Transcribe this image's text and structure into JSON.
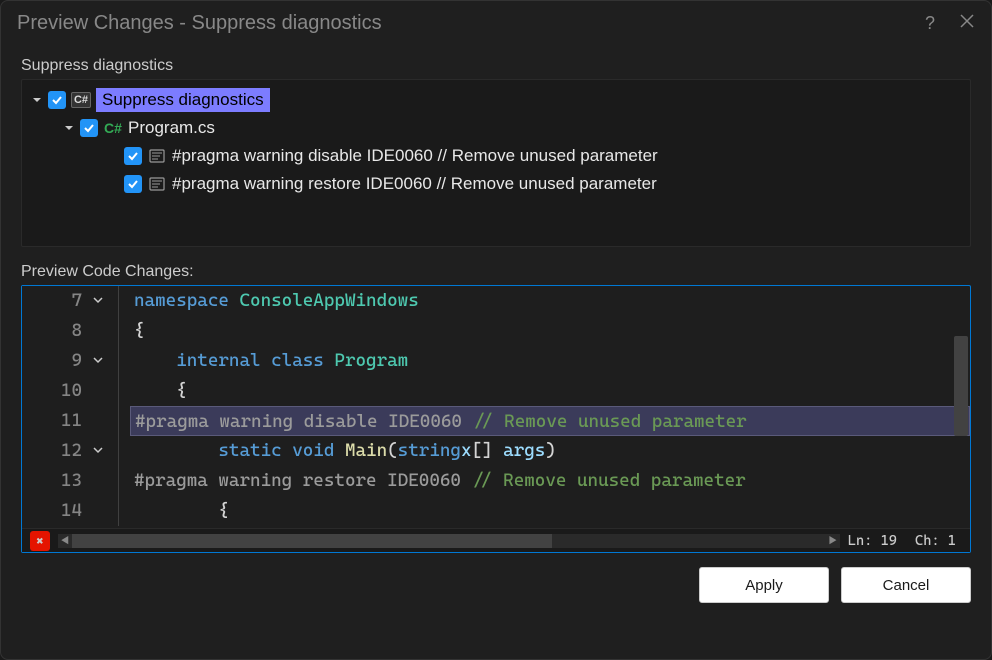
{
  "dialog": {
    "title": "Preview Changes - Suppress diagnostics"
  },
  "tree": {
    "section_label": "Suppress diagnostics",
    "root": {
      "label": "Suppress diagnostics"
    },
    "file": {
      "label": "Program.cs"
    },
    "changes": [
      {
        "label": "#pragma warning disable IDE0060 // Remove unused parameter"
      },
      {
        "label": "#pragma warning restore IDE0060 // Remove unused parameter"
      }
    ]
  },
  "preview": {
    "label": "Preview Code Changes:",
    "lines": [
      {
        "num": "7",
        "fold": "down",
        "tokens": [
          [
            "kw",
            "namespace "
          ],
          [
            "cls",
            "ConsoleAppWindows"
          ]
        ]
      },
      {
        "num": "8",
        "fold": "",
        "tokens": [
          [
            "punct",
            "{"
          ]
        ]
      },
      {
        "num": "9",
        "fold": "down",
        "tokens": [
          [
            "punct",
            "    "
          ],
          [
            "kw",
            "internal "
          ],
          [
            "kw",
            "class "
          ],
          [
            "cls",
            "Program"
          ]
        ]
      },
      {
        "num": "10",
        "fold": "",
        "tokens": [
          [
            "punct",
            "    {"
          ]
        ]
      },
      {
        "num": "11",
        "fold": "",
        "highlighted": true,
        "tokens": [
          [
            "pragma",
            "#pragma warning disable IDE0060 "
          ],
          [
            "comment",
            "// Remove unused parameter"
          ]
        ]
      },
      {
        "num": "12",
        "fold": "down",
        "tokens": [
          [
            "punct",
            "        "
          ],
          [
            "kw",
            "static "
          ],
          [
            "type",
            "void "
          ],
          [
            "fn",
            "Main"
          ],
          [
            "punct",
            "("
          ],
          [
            "kw",
            "string"
          ],
          [
            "var",
            "x"
          ],
          [
            "punct",
            "[] "
          ],
          [
            "var",
            "args"
          ],
          [
            "punct",
            ")"
          ]
        ]
      },
      {
        "num": "13",
        "fold": "",
        "tokens": [
          [
            "pragma",
            "#pragma warning restore IDE0060 "
          ],
          [
            "comment",
            "// Remove unused parameter"
          ]
        ]
      },
      {
        "num": "14",
        "fold": "",
        "tokens": [
          [
            "punct",
            "        {"
          ]
        ]
      }
    ],
    "status": {
      "line": "Ln: 19",
      "col": "Ch: 1"
    }
  },
  "buttons": {
    "apply": "Apply",
    "cancel": "Cancel"
  }
}
